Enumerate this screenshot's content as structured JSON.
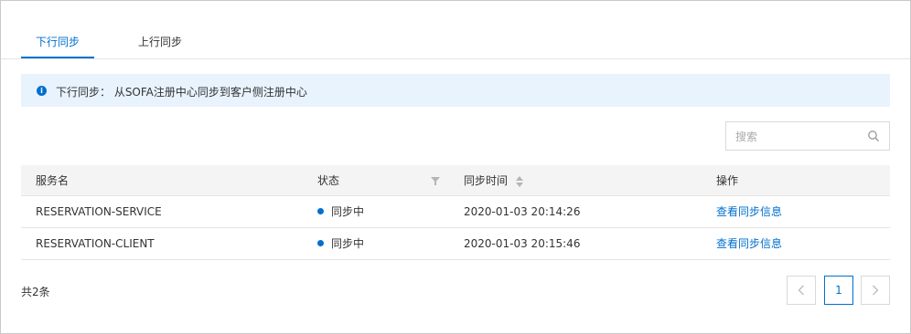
{
  "tabs": [
    {
      "label": "下行同步",
      "active": true
    },
    {
      "label": "上行同步",
      "active": false
    }
  ],
  "notice": {
    "icon": "info-icon",
    "text": "下行同步： 从SOFA注册中心同步到客户侧注册中心"
  },
  "search": {
    "placeholder": "搜索",
    "value": ""
  },
  "table": {
    "columns": [
      "服务名",
      "状态",
      "同步时间",
      "操作"
    ],
    "rows": [
      {
        "service": "RESERVATION-SERVICE",
        "status": "同步中",
        "time": "2020-01-03 20:14:26",
        "action": "查看同步信息"
      },
      {
        "service": "RESERVATION-CLIENT",
        "status": "同步中",
        "time": "2020-01-03 20:15:46",
        "action": "查看同步信息"
      }
    ]
  },
  "footer": {
    "total": "共2条",
    "current_page": "1"
  },
  "colors": {
    "accent": "#0070cc",
    "notice_bg": "#e8f3fd",
    "header_bg": "#f4f4f4"
  }
}
